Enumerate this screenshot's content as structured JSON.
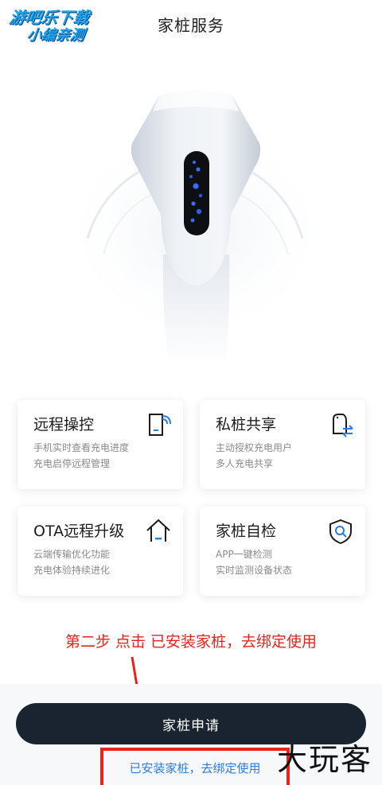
{
  "header": {
    "title": "家桩服务"
  },
  "watermark_top": {
    "line1": "游吧乐下载",
    "line2": "小编亲测"
  },
  "cards": [
    {
      "title": "远程操控",
      "desc1": "手机实时查看充电进度",
      "desc2": "充电启停远程管理",
      "icon": "remote-control-icon"
    },
    {
      "title": "私桩共享",
      "desc1": "主动授权充电用户",
      "desc2": "多人充电共享",
      "icon": "share-icon"
    },
    {
      "title": "OTA远程升级",
      "desc1": "云端传输优化功能",
      "desc2": "充电体验持续进化",
      "icon": "upgrade-home-icon"
    },
    {
      "title": "家桩自检",
      "desc1": "APP一键检测",
      "desc2": "实时监测设备状态",
      "icon": "shield-search-icon"
    }
  ],
  "annotation": {
    "text": "第二步 点击 已安装家桩，去绑定使用"
  },
  "actions": {
    "apply_label": "家桩申请",
    "installed_label": "已安装家桩，去绑定使用"
  },
  "watermark_bottom": {
    "text": "大玩客"
  },
  "colors": {
    "accent_dark": "#1a2430",
    "link_blue": "#2a7de1",
    "annotation_red": "#e8231e"
  }
}
